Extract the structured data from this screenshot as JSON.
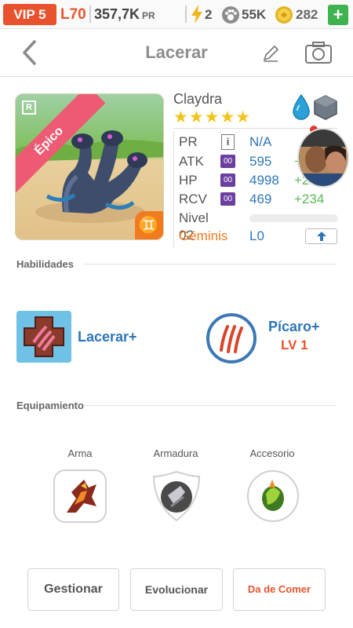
{
  "status_bar": {
    "vip": "VIP 5",
    "level": "L70",
    "power_value": "357,7K",
    "power_label": "PR",
    "energy": "2",
    "food": "55K",
    "coins": "282",
    "add": "+"
  },
  "header": {
    "title": "Lacerar",
    "back_icon": "chevron-left-icon",
    "edit_icon": "pencil-icon",
    "camera_icon": "camera-icon"
  },
  "creature": {
    "rarity_letter": "R",
    "rarity": "Épico",
    "zodiac_symbol": "♊",
    "name": "Claydra",
    "stars": "★★★★★",
    "star_count": 5,
    "elements": [
      "water-drop-icon",
      "rock-icon"
    ],
    "stats": [
      {
        "label": "PR",
        "badge": "i",
        "value": "N/A",
        "bonus": ""
      },
      {
        "label": "ATK",
        "badge": "00",
        "value": "595",
        "bonus": "+"
      },
      {
        "label": "HP",
        "badge": "00",
        "value": "4998",
        "bonus": "+2"
      },
      {
        "label": "RCV",
        "badge": "00",
        "value": "469",
        "bonus": "+234"
      }
    ],
    "level_label": "Nivel 02",
    "level_progress": 0,
    "zodiac_name": "Géminis",
    "limit": "L0",
    "upgrade_icon": "arrow-up-icon"
  },
  "abilities": {
    "title": "Habilidades",
    "items": [
      {
        "name": "Lacerar+",
        "level": ""
      },
      {
        "name": "Pícaro+",
        "level": "LV 1"
      }
    ]
  },
  "equipment": {
    "title": "Equipamiento",
    "slots": [
      {
        "label": "Arma",
        "icon": "weapon-icon"
      },
      {
        "label": "Armadura",
        "icon": "armor-icon"
      },
      {
        "label": "Accesorio",
        "icon": "accessory-icon"
      }
    ]
  },
  "actions": {
    "manage": "Gestionar",
    "evolve": "Evolucionar",
    "feed": "Da de Comer"
  },
  "colors": {
    "accent": "#2e76b8",
    "vip": "#e8532d",
    "bonus": "#59b855",
    "zodiac": "#f07a20",
    "rarity": "#ee5a73",
    "stars": "#f2c41a"
  }
}
